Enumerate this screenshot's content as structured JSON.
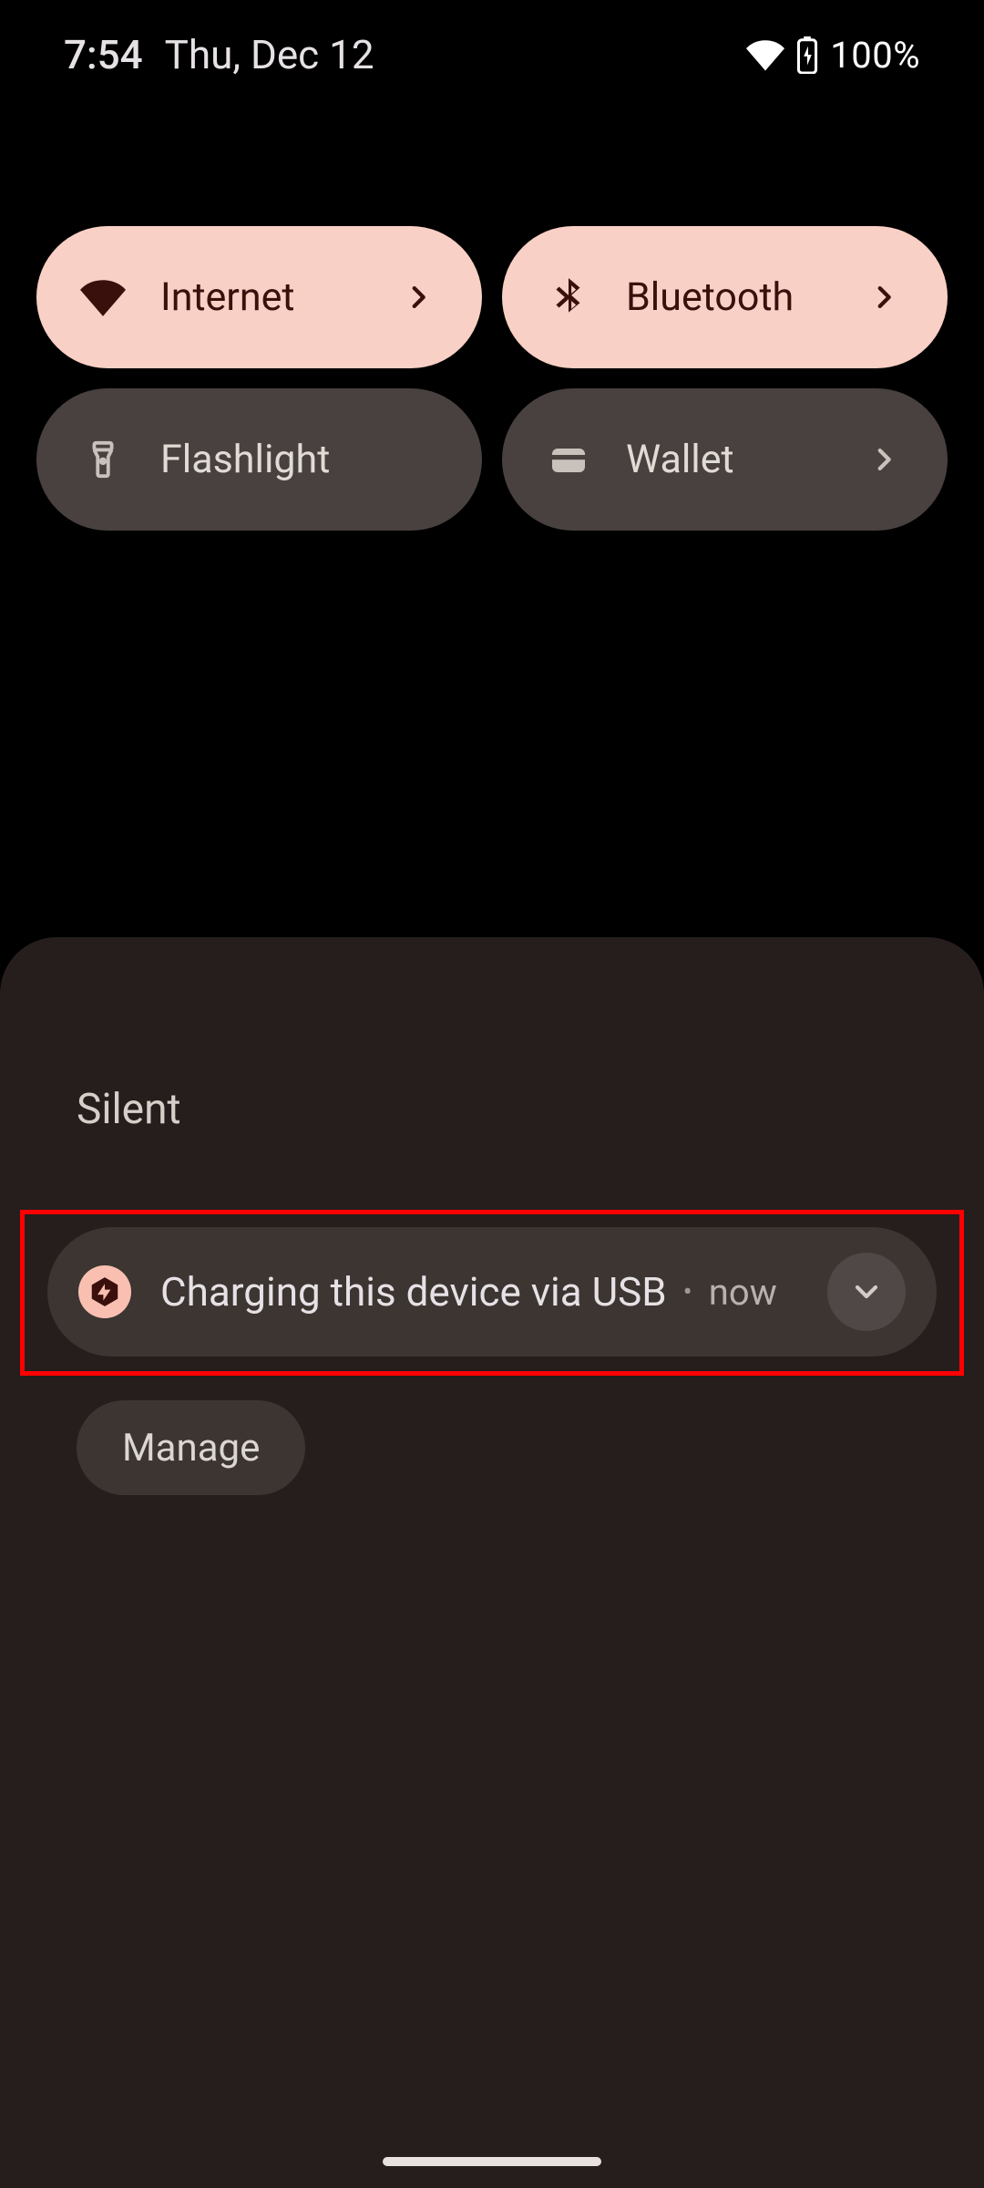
{
  "status": {
    "time": "7:54",
    "date": "Thu, Dec 12",
    "battery_pct": "100%"
  },
  "qs": [
    {
      "id": "internet",
      "label": "Internet",
      "icon": "wifi-icon",
      "on": true,
      "chevron": true
    },
    {
      "id": "bluetooth",
      "label": "Bluetooth",
      "icon": "bluetooth-icon",
      "on": true,
      "chevron": true
    },
    {
      "id": "flashlight",
      "label": "Flashlight",
      "icon": "flashlight-icon",
      "on": false,
      "chevron": false
    },
    {
      "id": "wallet",
      "label": "Wallet",
      "icon": "wallet-icon",
      "on": false,
      "chevron": true
    }
  ],
  "section_label": "Silent",
  "notification": {
    "title": "Charging this device via USB",
    "time": "now",
    "icon": "android-system-icon"
  },
  "manage_label": "Manage",
  "colors": {
    "tile_on": "#F9D0C5",
    "tile_off": "#48413F",
    "panel": "#251E1C",
    "highlight": "#FF0000"
  }
}
